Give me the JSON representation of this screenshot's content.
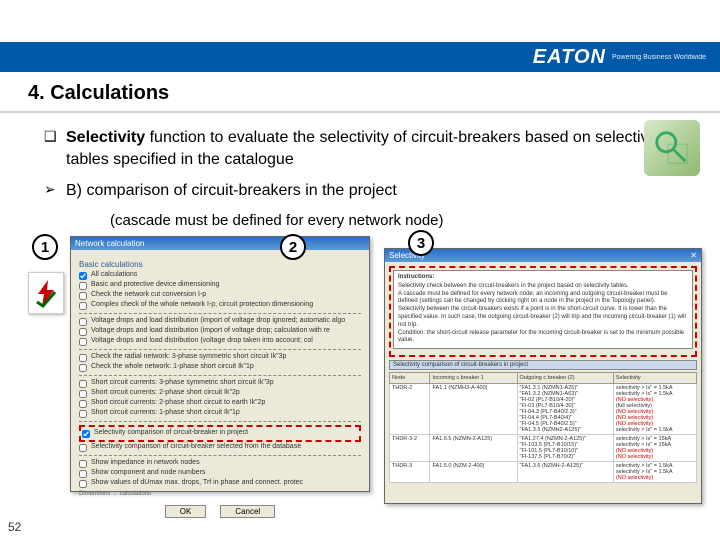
{
  "brand": {
    "name": "EATON",
    "tagline": "Powering Business Worldwide"
  },
  "section": {
    "title": "4. Calculations"
  },
  "bullet1": {
    "marker": "❑",
    "bold": "Selectivity",
    "rest": " function to evaluate the selectivity of circuit-breakers based on selectivity tables specified in the catalogue"
  },
  "bullet2": {
    "marker": "➢",
    "text": "B) comparison of circuit-breakers in the project"
  },
  "subline": "(cascade must be defined for every network node)",
  "labels": {
    "one": "1",
    "two": "2",
    "three": "3"
  },
  "panelA": {
    "title": "Network calculation",
    "group_basic": "Basic calculations",
    "all": "All calculations",
    "b1": "Basic and protective device dimensioning",
    "b2": "Check the network cut conversion I-p",
    "b3": "Complex check of the whole network I-p, circuit protection dimensioning",
    "group_drops": "",
    "d1": "Voltage drops and load distribution (import of voltage drop ignored; automatic algo",
    "d2": "Voltage drops and load distribution (import of voltage drop; calculation with re",
    "d3": "Voltage drops and load distribution (voltage drop taken into account; col",
    "group_net": "",
    "n1": "Check the radial network: 3-phase symmetric short circuit Ik\"3p",
    "n2": "Check the whole network: 1-phase short circuit Ik\"1p",
    "group_sc": "",
    "s1": "Short circuit currents: 3-phase symmetric short circuit Ik\"3p",
    "s2": "Short circuit currents: 2-phase short circuit Ik\"2p",
    "s3": "Short circuit currents: 2-phase short circuit to earth Ik\"2p",
    "s4": "Short circuit currents: 1-phase short circuit Ik\"1p",
    "group_sel": "",
    "sel1": "Selectivity comparison of circuit-breaker in project",
    "sel2": "Selectivity comparison of circuit-breaker selected from the database",
    "group_imp": "",
    "i1": "Show impedance in network nodes",
    "i2": "Show component and node numbers",
    "i3": "Show values of dUmax max. drops, Trf in phase and connect. protec",
    "note": "Dimensions → calculations",
    "ok": "OK",
    "cancel": "Cancel"
  },
  "panelB": {
    "title": "Selectivity",
    "instr_title": "Instructions:",
    "instr_l1": "Selectivity check between the circuit-breakers in the project based on selectivity tables.",
    "instr_l2": "A cascade must be defined for every network node; an incoming and outgoing circuit-breaker must be defined (settings can be changed by clicking right on a node in the project in the Topology panel).",
    "instr_l3": "Selectivity between the circuit-breakers exists if a point is in the short-circuit curve. It is lower than the specified value. In such case, the outgoing circuit-breaker (2) will trip and the incoming circuit-breaker (1) will not trip.",
    "instr_l4": "Condition: the short-circuit release parameter for the incoming circuit-breaker is set to the minimum possible value.",
    "banner": "Selectivity comparison of circuit-breakers in project",
    "cols": {
      "node": "Node",
      "incoming": "Incoming c.breaker 1",
      "outgoing": "Outgoing c.breaker (2)",
      "sel": "Selectivity"
    },
    "rows": [
      {
        "node": "THDR-2",
        "incoming": "FA1.1 (NZMH3-A-400)",
        "outgoing": [
          "FA1.3.1 (NZMN1-A25)",
          "FA1.3.2 (NZMN1-A63)",
          "FI-02 (PL7-B10/4-20)",
          "FI-03 (PL7-B10/4-30)",
          "FI-04.3 (PL7-B40/2.3)",
          "FI-04.4 (PL7-B40/4)",
          "FI-04.5 (PL7-B40/2.5)",
          "FA1.3.5 (NZMH2-A125)"
        ],
        "sel": [
          "selectivity > Is\" = 1.5kA",
          "selectivity > Is\" = 1.5kA",
          "(NO selectivity)",
          "(full selectivity)",
          "(NO selectivity)",
          "(NO selectivity)",
          "(NO selectivity)",
          "selectivity > Is\" = 1.5kA"
        ]
      },
      {
        "node": "THDR-3-2",
        "incoming": "FA1.6.5 (NZMN-2-A125)",
        "outgoing": [
          "FA1.27.4 (NZMN-2-A125)",
          "FI-103.5 (PL7-B10/15)",
          "FI-101.5 (PL7-B10/10)",
          "FI-137.5 (PL7-B70/2)"
        ],
        "sel": [
          "selectivity > Is\" = 15kA",
          "selectivity > Is\" = 15kA",
          "(NO selectivity)",
          "(NO selectivity)"
        ]
      },
      {
        "node": "THDR-3",
        "incoming": "FA1.5.0 (NZM-2-400)",
        "outgoing": [
          "FA1.3.6 (NZMH-2-A125)"
        ],
        "sel": [
          "selectivity > Is\" = 1.5kA",
          "selectivity > Is\" = 1.5kA",
          "(NO selectivity)"
        ]
      }
    ]
  },
  "page": "52"
}
